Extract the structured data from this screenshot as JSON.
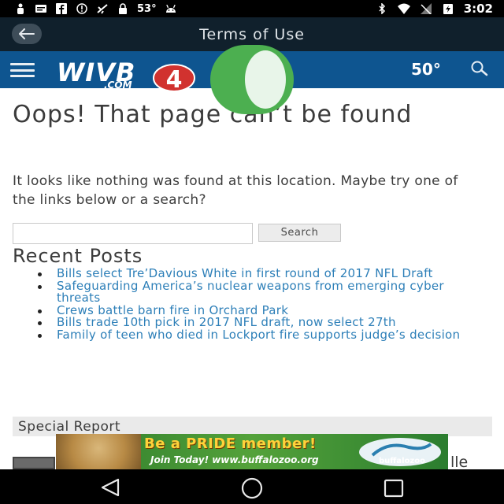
{
  "status_bar": {
    "temperature": "53°",
    "time": "3:02",
    "icons": [
      "person-icon",
      "message-icon",
      "facebook-icon",
      "alert-icon",
      "airplane-icon",
      "lock-icon",
      "android-icon",
      "bluetooth-icon",
      "wifi-icon",
      "signal-icon",
      "battery-charging-icon"
    ]
  },
  "app_bar": {
    "title": "Terms of Use",
    "back_icon": "back-arrow-icon"
  },
  "site_header": {
    "logo_text": "WIVB",
    "logo_dotcom": ".COM",
    "logo_number": "4",
    "temperature": "50°",
    "menu_icon": "hamburger-icon",
    "search_icon": "search-icon"
  },
  "main": {
    "heading": "Oops! That page can’t be found",
    "message": "It looks like nothing was found at this location. Maybe try one of the links below or a search?",
    "search_placeholder": "",
    "search_button": "Search",
    "recent_posts_title": "Recent Posts",
    "recent_posts": [
      "Bills select Tre’Davious White in first round of 2017 NFL Draft",
      "Safeguarding America’s nuclear weapons from emerging cyber threats",
      "Crews battle barn fire in Orchard Park",
      "Bills trade 10th pick in 2017 NFL draft, now select 27th",
      "Family of teen who died in Lockport fire supports judge’s decision"
    ],
    "special_report": "Special Report",
    "partial_text": "lle"
  },
  "ad": {
    "headline": "Be a PRIDE member!",
    "subline": "Join Today! www.buffalozoo.org",
    "logo_text": "buffalozoo"
  },
  "colors": {
    "status_bar": "#000000",
    "app_bar": "#10202c",
    "site_header": "#0e5590",
    "link": "#2d7fb8",
    "overlay_toggle": "#4caf50"
  },
  "nav_bar": {
    "icons": [
      "nav-back-icon",
      "nav-home-icon",
      "nav-recents-icon"
    ]
  }
}
